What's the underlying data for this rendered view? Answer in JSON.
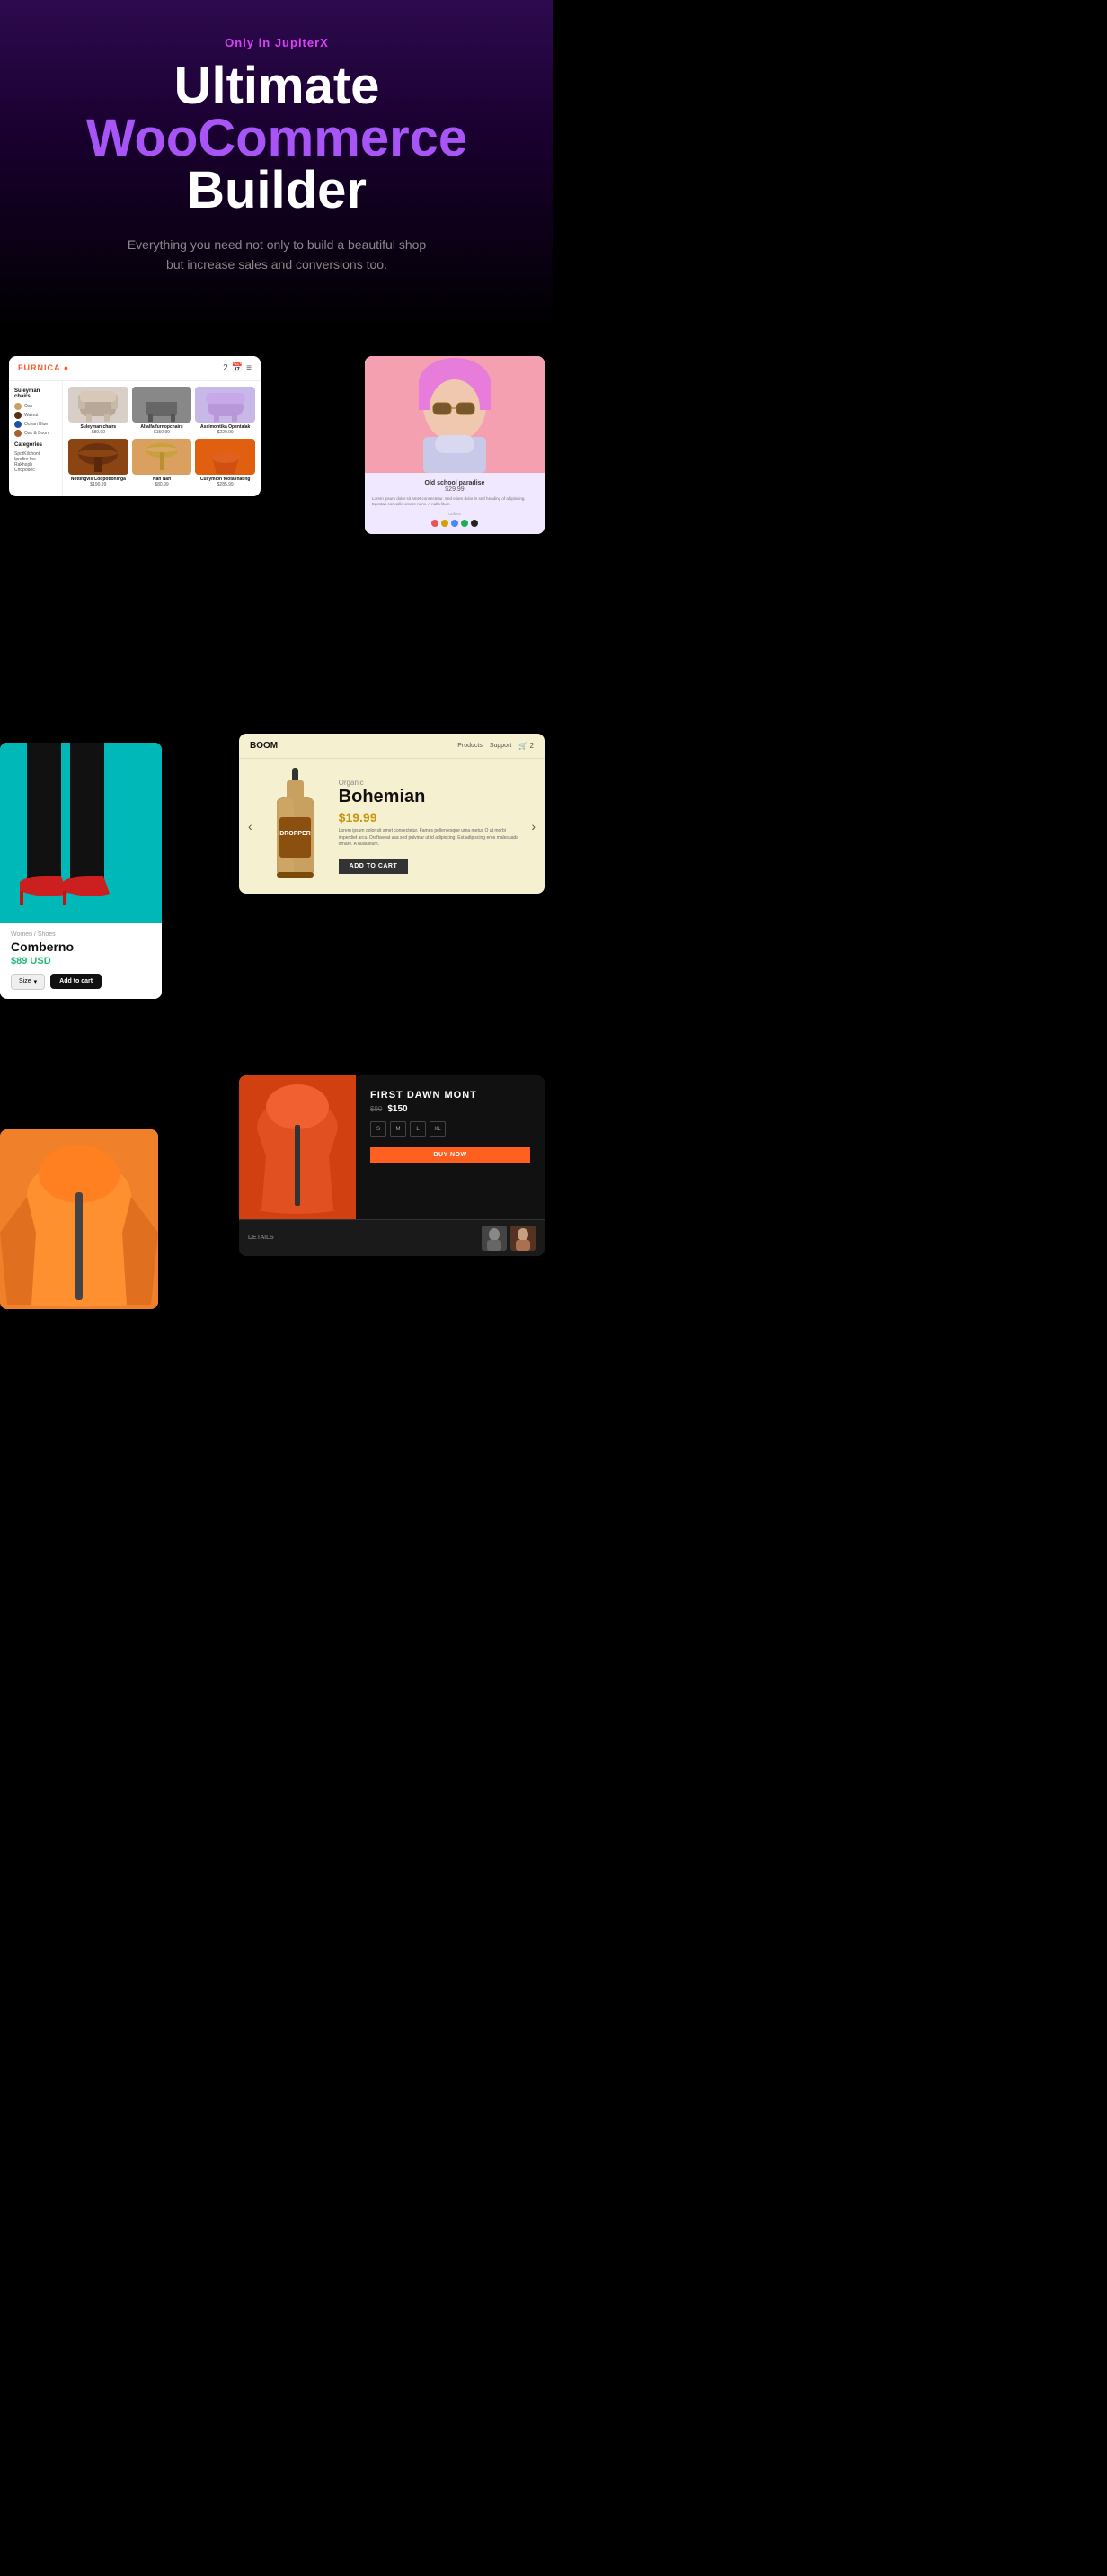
{
  "hero": {
    "tagline": "Only in JupiterX",
    "title_line1": "Ultimate",
    "title_line2": "WooCommerce",
    "title_line3": "Builder",
    "subtitle": "Everything you need not only to build a beautiful shop but increase sales and conversions too."
  },
  "furniture_store": {
    "logo": "FURNICA",
    "logo_dot": "●",
    "category_title": "Suleyman chairs",
    "colors": [
      {
        "name": "Oak",
        "color": "#c8a060"
      },
      {
        "name": "Walnut",
        "color": "#5a3010"
      },
      {
        "name": "Ocean Blue",
        "color": "#2050a0"
      },
      {
        "name": "Oak & Boom",
        "color": "#a86030"
      }
    ],
    "categories_title": "Categories",
    "categories": [
      "SpotKilchont",
      "Iprofire Inc",
      "Rakhoph",
      "Chopodec"
    ],
    "products": [
      {
        "name": "Suleyman chairs",
        "price": "$89.99"
      },
      {
        "name": "Alfalfa furnopchairs",
        "price": "$150.99"
      },
      {
        "name": "Assimontika Opentalak",
        "price": "$220.99"
      },
      {
        "name": "Nottingvis Coopotioninga",
        "price": "$190.99"
      },
      {
        "name": "Nah Nah",
        "price": "$80.99"
      },
      {
        "name": "Cusymion footalinating",
        "price": "$285.99"
      }
    ]
  },
  "sunglasses_store": {
    "product_name": "Old school paradise",
    "price": "$29.99",
    "description": "Lorem ipsum dolor sit amet consectetur. Sed etiam dolor in sed heading of adipiscing. Egestas convallis ornare nunc. A nulla litum.",
    "colors_label": "colors",
    "swatches": [
      "#e85555",
      "#d4a000",
      "#4488ff",
      "#22aa55",
      "#222"
    ]
  },
  "shoes_store": {
    "breadcrumb": "Women / Shoes",
    "product_name": "Comberno",
    "price": "$89 USD",
    "size_label": "Size",
    "add_to_cart": "Add to cart"
  },
  "boom_store": {
    "logo": "BOOM",
    "nav_items": [
      "Products",
      "Support"
    ],
    "cart_count": "2",
    "organic_label": "Organic",
    "product_name": "Bohemian",
    "price": "$19.99",
    "description": "Lorem ipsum dolor sit amet consectetur. Fames pellentesque urna metus O ut morbi imperdiet arcu. Draftaveat usa sed pulvinar ut id adipiscing. Est adipiscing eros malesuada ornare. A nulla litum.",
    "bottle_label": "DROPPER",
    "add_to_cart": "ADD TO CART"
  },
  "jacket_store": {
    "brand": "FIRST DAWN MONT",
    "old_price": "$90",
    "new_price": "$150",
    "sizes": [
      "S",
      "M",
      "L",
      "XL"
    ],
    "buy_label": "BUY NOW",
    "details_label": "DETAILS"
  }
}
